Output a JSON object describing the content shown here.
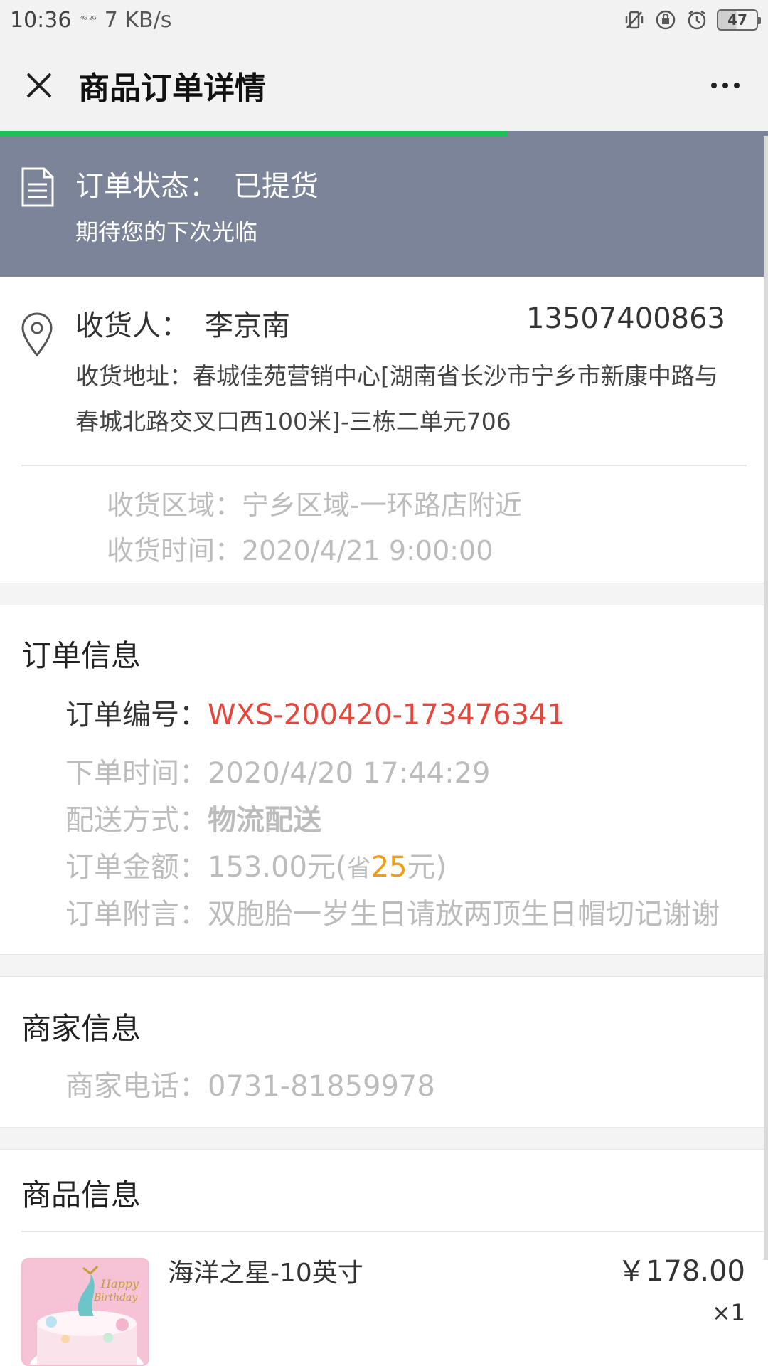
{
  "status_bar": {
    "time": "10:36",
    "signal": "⁴ᴳ ²ᴳ",
    "speed": "7 KB/s",
    "battery": "47"
  },
  "title_bar": {
    "title": "商品订单详情"
  },
  "page_progress": 0.66,
  "banner": {
    "label": "订单状态：",
    "status": "已提货",
    "subtitle": "期待您的下次光临"
  },
  "receiver": {
    "label": "收货人：",
    "name": "李京南",
    "phone": "13507400863",
    "address": "收货地址：春城佳苑营销中心[湖南省长沙市宁乡市新康中路与春城北路交叉口西100米]-三栋二单元706",
    "region": "收货区域：宁乡区域-一环路店附近",
    "time": "收货时间：2020/4/21 9:00:00"
  },
  "order_info": {
    "title": "订单信息",
    "number_label": "订单编号：",
    "number": "WXS-200420-173476341",
    "order_time_label": "下单时间：",
    "order_time": "2020/4/20 17:44:29",
    "delivery_label": "配送方式：",
    "delivery": "物流配送",
    "amount_label": "订单金额：",
    "amount": "153.00元(",
    "save_prefix": "省",
    "save_amount": "25",
    "save_suffix": "元)",
    "note_label": "订单附言：",
    "note": "双胞胎一岁生日请放两顶生日帽切记谢谢"
  },
  "merchant_info": {
    "title": "商家信息",
    "phone_label": "商家电话：",
    "phone": "0731-81859978"
  },
  "product_info": {
    "title": "商品信息",
    "items": [
      {
        "name": "海洋之星-10英寸",
        "price": "￥178.00",
        "qty": "×1",
        "image": "cake-image"
      }
    ]
  },
  "colors": {
    "banner": "#7b8499",
    "progress": "#1fbf5a",
    "order_number": "#e8453c",
    "save_amount": "#f39c12"
  }
}
